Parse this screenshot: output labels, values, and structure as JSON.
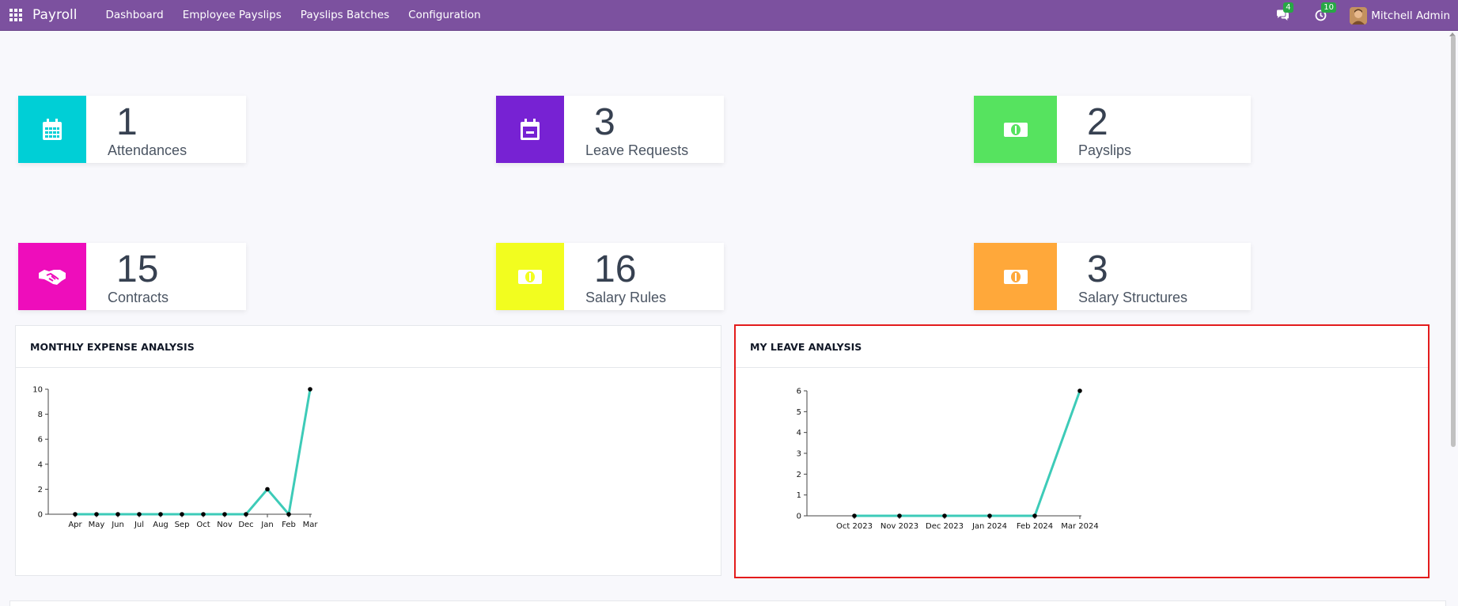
{
  "navbar": {
    "brand": "Payroll",
    "menu": [
      "Dashboard",
      "Employee Payslips",
      "Payslips Batches",
      "Configuration"
    ],
    "messages_badge": "4",
    "activities_badge": "10",
    "user_name": "Mitchell Admin"
  },
  "kpis": [
    {
      "value": "1",
      "label": "Attendances",
      "color": "#00cfd6",
      "icon": "calendar-icon"
    },
    {
      "value": "3",
      "label": "Leave Requests",
      "color": "#7722d3",
      "icon": "calendar-minus-icon"
    },
    {
      "value": "2",
      "label": "Payslips",
      "color": "#56e35f",
      "icon": "money-icon"
    },
    {
      "value": "15",
      "label": "Contracts",
      "color": "#ee0dbb",
      "icon": "handshake-icon"
    },
    {
      "value": "16",
      "label": "Salary Rules",
      "color": "#f2fd1f",
      "icon": "money-icon"
    },
    {
      "value": "3",
      "label": "Salary Structures",
      "color": "#ffa83a",
      "icon": "money-icon"
    }
  ],
  "panels": {
    "expense_title": "MONTHLY EXPENSE ANALYSIS",
    "leave_title": "MY LEAVE ANALYSIS"
  },
  "chart_data": [
    {
      "type": "line",
      "title": "MONTHLY EXPENSE ANALYSIS",
      "categories": [
        "Apr",
        "May",
        "Jun",
        "Jul",
        "Aug",
        "Sep",
        "Oct",
        "Nov",
        "Dec",
        "Jan",
        "Feb",
        "Mar"
      ],
      "values": [
        0,
        0,
        0,
        0,
        0,
        0,
        0,
        0,
        0,
        2,
        0,
        10
      ],
      "ylim": [
        0,
        10
      ],
      "yticks": [
        0,
        2,
        4,
        6,
        8,
        10
      ],
      "line_color": "#3dcbb8"
    },
    {
      "type": "line",
      "title": "MY LEAVE ANALYSIS",
      "categories": [
        "Oct 2023",
        "Nov 2023",
        "Dec 2023",
        "Jan 2024",
        "Feb 2024",
        "Mar 2024"
      ],
      "values": [
        0,
        0,
        0,
        0,
        0,
        6
      ],
      "ylim": [
        0,
        6
      ],
      "yticks": [
        0,
        1,
        2,
        3,
        4,
        5,
        6
      ],
      "line_color": "#3dcbb8"
    }
  ]
}
